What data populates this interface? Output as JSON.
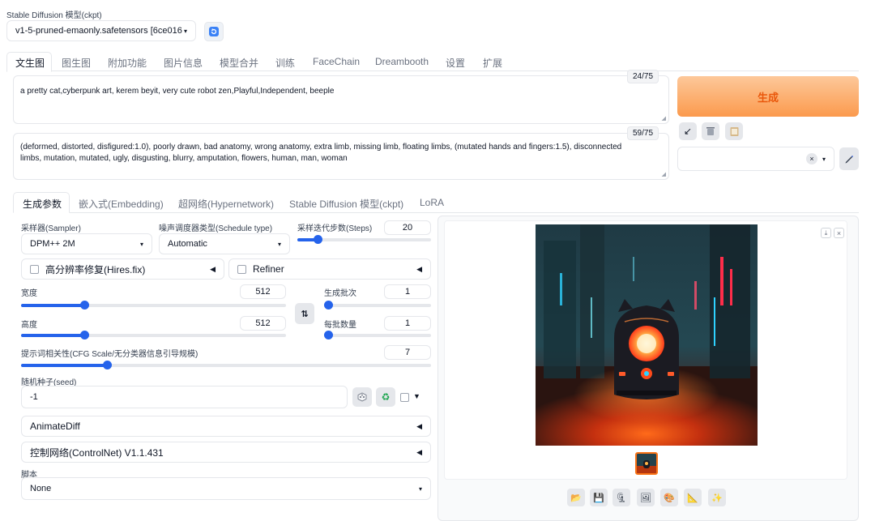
{
  "model": {
    "label": "Stable Diffusion 模型(ckpt)",
    "selected": "v1-5-pruned-emaonly.safetensors [6ce016",
    "refresh_icon": "refresh-icon"
  },
  "main_tabs": [
    "文生图",
    "图生图",
    "附加功能",
    "图片信息",
    "模型合并",
    "训练",
    "FaceChain",
    "Dreambooth",
    "设置",
    "扩展"
  ],
  "prompt": {
    "text": "a pretty cat,cyberpunk art, kerem beyit, very cute robot zen,Playful,Independent, beeple",
    "counter": "24/75"
  },
  "negative_prompt": {
    "text": "(deformed, distorted, disfigured:1.0), poorly drawn, bad anatomy, wrong anatomy, extra limb, missing limb, floating limbs, (mutated hands and fingers:1.5), disconnected limbs, mutation, mutated, ugly, disgusting, blurry, amputation, flowers, human, man, woman",
    "counter": "59/75"
  },
  "generate_label": "生成",
  "style_clear": "×",
  "sub_tabs": [
    "生成参数",
    "嵌入式(Embedding)",
    "超网络(Hypernetwork)",
    "Stable Diffusion 模型(ckpt)",
    "LoRA"
  ],
  "params": {
    "sampler_label": "采样器(Sampler)",
    "sampler_value": "DPM++ 2M",
    "schedule_label": "噪声调度器类型(Schedule type)",
    "schedule_value": "Automatic",
    "steps_label": "采样迭代步数(Steps)",
    "steps_value": "20",
    "steps_fraction": 0.15,
    "hires_label": "高分辨率修复(Hires.fix)",
    "refiner_label": "Refiner",
    "width_label": "宽度",
    "width_value": "512",
    "width_fraction": 0.24,
    "height_label": "高度",
    "height_value": "512",
    "height_fraction": 0.24,
    "batch_count_label": "生成批次",
    "batch_count_value": "1",
    "batch_count_fraction": 0.0,
    "batch_size_label": "每批数量",
    "batch_size_value": "1",
    "batch_size_fraction": 0.0,
    "cfg_label": "提示词相关性(CFG Scale/无分类器信息引导规模)",
    "cfg_value": "7",
    "cfg_fraction": 0.21,
    "seed_label": "随机种子(seed)",
    "seed_value": "-1",
    "animatediff_label": "AnimateDiff",
    "controlnet_label": "控制网络(ControlNet) V1.1.431",
    "script_label": "脚本",
    "script_value": "None"
  },
  "colors": {
    "accent": "#2563eb",
    "generate_from": "#fdba74",
    "generate_to": "#fb923c",
    "generate_text": "#ea580c"
  }
}
